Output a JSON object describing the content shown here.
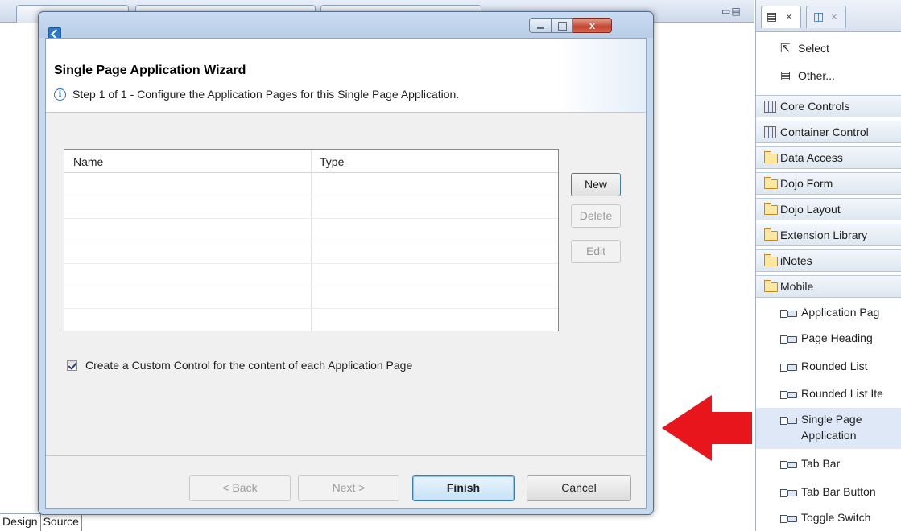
{
  "editor": {
    "bottom_tabs": [
      "Design",
      "Source"
    ]
  },
  "palette": {
    "select_label": "Select",
    "other_label": "Other...",
    "drawers": [
      "Core Controls",
      "Container Control",
      "Data Access",
      "Dojo Form",
      "Dojo Layout",
      "Extension Library",
      "iNotes",
      "Mobile"
    ],
    "mobile_items": [
      "Application Pag",
      "Page Heading",
      "Rounded List",
      "Rounded List Ite",
      "Single Page",
      "Application",
      "Tab Bar",
      "Tab Bar Button",
      "Toggle Switch"
    ]
  },
  "dialog": {
    "title": "Single Page Application Wizard",
    "description": "Step 1 of 1 - Configure the Application Pages for this Single Page Application.",
    "table": {
      "columns": [
        "Name",
        "Type"
      ],
      "rows": []
    },
    "side_buttons": {
      "new": "New",
      "delete": "Delete",
      "edit": "Edit"
    },
    "checkbox": {
      "label": "Create a Custom Control for the content of each Application Page",
      "checked": true
    },
    "buttons": {
      "back": "< Back",
      "next": "Next >",
      "finish": "Finish",
      "cancel": "Cancel"
    },
    "close_glyph": "x"
  },
  "colors": {
    "arrow": "#e8161c",
    "accent": "#3c7fb1"
  }
}
